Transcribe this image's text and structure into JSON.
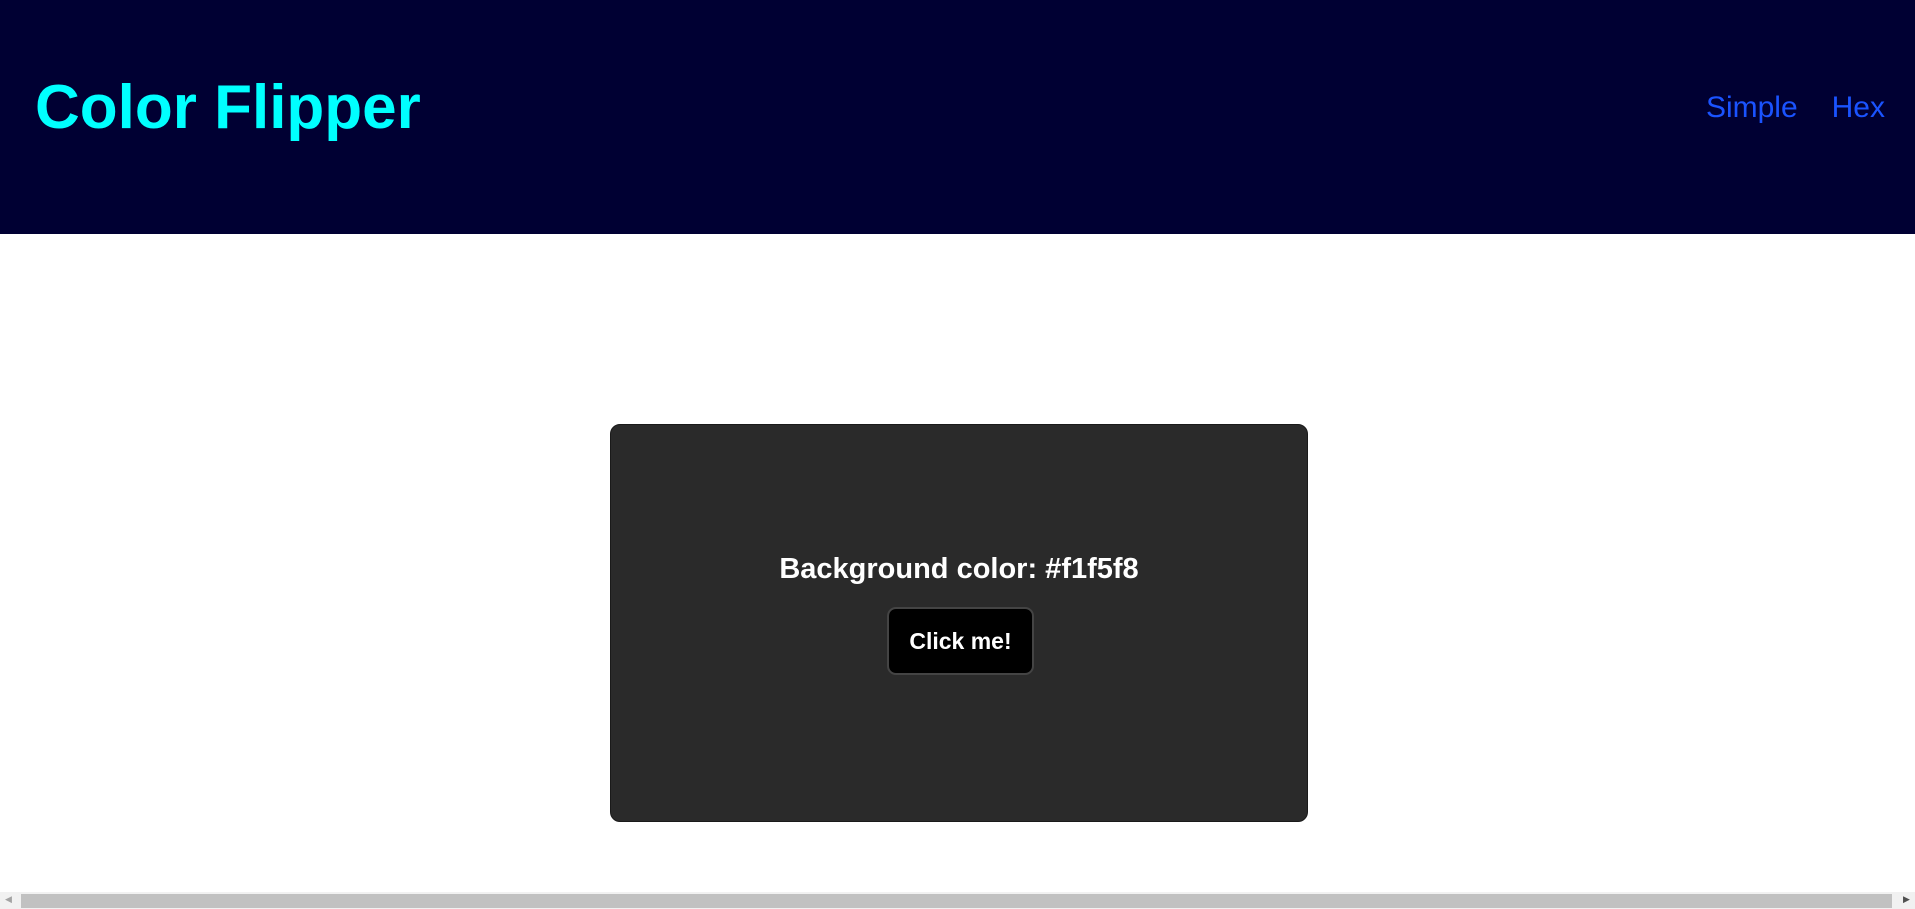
{
  "header": {
    "title": "Color Flipper",
    "nav": [
      {
        "label": "Simple"
      },
      {
        "label": "Hex"
      }
    ]
  },
  "main": {
    "color_label": "Background color: #f1f5f8",
    "button_label": "Click me!"
  },
  "colors": {
    "header_bg": "#000033",
    "title": "#00ffff",
    "nav_link": "#1a53ff",
    "card_bg": "#2a2a2a",
    "button_bg": "#000000"
  },
  "scrollbar": {
    "left_icon": "scroll-left-arrow-icon",
    "right_icon": "scroll-right-arrow-icon"
  }
}
